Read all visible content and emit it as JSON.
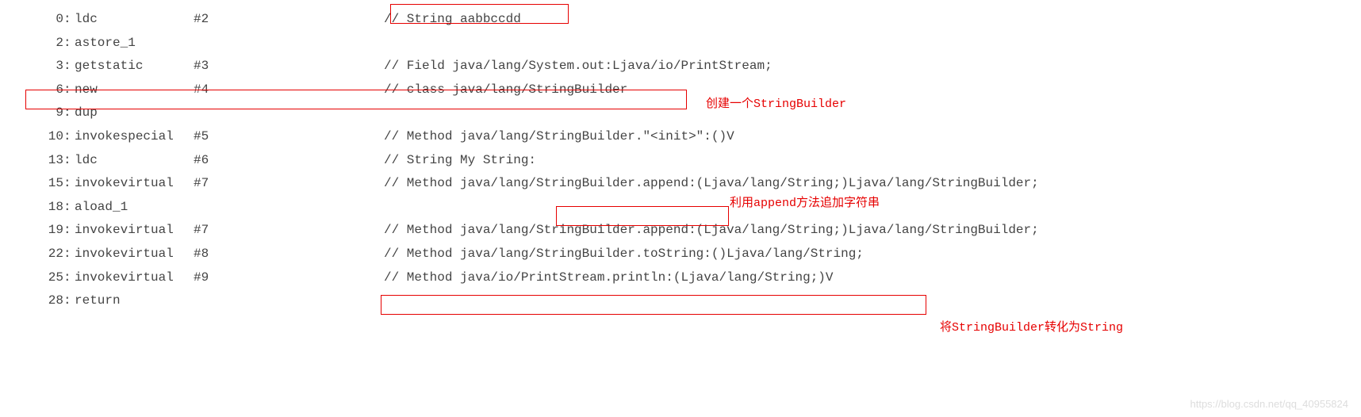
{
  "lines": [
    {
      "offset": "0",
      "instr": "ldc",
      "arg": "#2",
      "comment": "// String aabbccdd"
    },
    {
      "offset": "2",
      "instr": "astore_1",
      "arg": "",
      "comment": ""
    },
    {
      "offset": "3",
      "instr": "getstatic",
      "arg": "#3",
      "comment": "// Field java/lang/System.out:Ljava/io/PrintStream;"
    },
    {
      "offset": "6",
      "instr": "new",
      "arg": "#4",
      "comment": "// class java/lang/StringBuilder"
    },
    {
      "offset": "9",
      "instr": "dup",
      "arg": "",
      "comment": ""
    },
    {
      "offset": "10",
      "instr": "invokespecial",
      "arg": "#5",
      "comment": "// Method java/lang/StringBuilder.\"<init>\":()V"
    },
    {
      "offset": "13",
      "instr": "ldc",
      "arg": "#6",
      "comment": "// String My String:"
    },
    {
      "offset": "15",
      "instr": "invokevirtual",
      "arg": "#7",
      "comment": "// Method java/lang/StringBuilder.append:(Ljava/lang/String;)Ljava/lang/StringBuilder;"
    },
    {
      "offset": "18",
      "instr": "aload_1",
      "arg": "",
      "comment": ""
    },
    {
      "offset": "19",
      "instr": "invokevirtual",
      "arg": "#7",
      "comment": "// Method java/lang/StringBuilder.append:(Ljava/lang/String;)Ljava/lang/StringBuilder;"
    },
    {
      "offset": "22",
      "instr": "invokevirtual",
      "arg": "#8",
      "comment": "// Method java/lang/StringBuilder.toString:()Ljava/lang/String;"
    },
    {
      "offset": "25",
      "instr": "invokevirtual",
      "arg": "#9",
      "comment": "// Method java/io/PrintStream.println:(Ljava/lang/String;)V"
    },
    {
      "offset": "28",
      "instr": "return",
      "arg": "",
      "comment": ""
    }
  ],
  "annotations": {
    "a1": "创建一个StringBuilder",
    "a2": "利用append方法追加字符串",
    "a3": "将StringBuilder转化为String"
  },
  "watermark": "https://blog.csdn.net/qq_40955824"
}
